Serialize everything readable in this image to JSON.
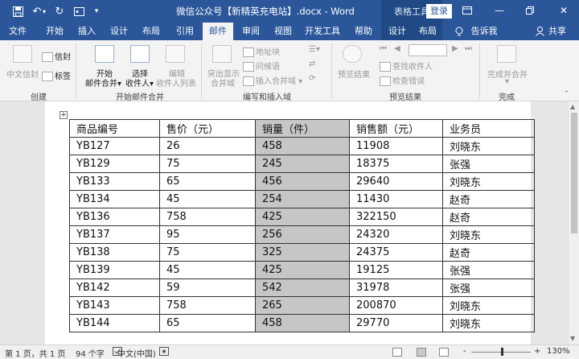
{
  "titlebar": {
    "title": "微信公众号【新精英充电站】.docx - Word",
    "tool_context": "表格工具",
    "login": "登录",
    "icons": [
      "save-icon",
      "undo-icon",
      "redo-icon",
      "customize-icon",
      "ribbon-display-icon",
      "minimize-icon",
      "restore-icon",
      "close-icon"
    ]
  },
  "tabs": [
    {
      "label": "文件"
    },
    {
      "label": "开始"
    },
    {
      "label": "插入"
    },
    {
      "label": "设计"
    },
    {
      "label": "布局"
    },
    {
      "label": "引用"
    },
    {
      "label": "邮件",
      "active": true
    },
    {
      "label": "审阅"
    },
    {
      "label": "视图"
    },
    {
      "label": "开发工具"
    },
    {
      "label": "帮助"
    },
    {
      "label": "设计"
    },
    {
      "label": "布局"
    }
  ],
  "tell_me": "告诉我",
  "share": "共享",
  "ribbon": {
    "groups": {
      "create": "创建",
      "start_merge": "开始邮件合并",
      "write_insert": "编写和插入域",
      "preview": "预览结果",
      "finish": "完成"
    },
    "buttons": {
      "cn_envelope": "中文信封",
      "envelope": "信封",
      "labels": "标签",
      "start_merge_1": "开始",
      "start_merge_2": "邮件合并",
      "select_recipients_1": "选择",
      "select_recipients_2": "收件人",
      "edit_list_1": "编辑",
      "edit_list_2": "收件人列表",
      "highlight_1": "突出显示",
      "highlight_2": "合并域",
      "address_block": "地址块",
      "greeting_line": "问候语",
      "insert_merge_field": "插入合并域",
      "preview_results": "预览结果",
      "find_recipient": "查找收件人",
      "check_errors": "检查错误",
      "finish_merge": "完成并合并"
    }
  },
  "table": {
    "headers": [
      "商品编号",
      "售价（元）",
      "销量（件）",
      "销售额（元）",
      "业务员"
    ],
    "rows": [
      [
        "YB127",
        "26",
        "458",
        "11908",
        "刘晓东"
      ],
      [
        "YB129",
        "75",
        "245",
        "18375",
        "张强"
      ],
      [
        "YB133",
        "65",
        "456",
        "29640",
        "刘晓东"
      ],
      [
        "YB134",
        "45",
        "254",
        "11430",
        "赵奇"
      ],
      [
        "YB136",
        "758",
        "425",
        "322150",
        "赵奇"
      ],
      [
        "YB137",
        "95",
        "256",
        "24320",
        "刘晓东"
      ],
      [
        "YB138",
        "75",
        "325",
        "24375",
        "赵奇"
      ],
      [
        "YB139",
        "45",
        "425",
        "19125",
        "张强"
      ],
      [
        "YB142",
        "59",
        "542",
        "31978",
        "张强"
      ],
      [
        "YB143",
        "758",
        "265",
        "200870",
        "刘晓东"
      ],
      [
        "YB144",
        "65",
        "458",
        "29770",
        "刘晓东"
      ]
    ],
    "highlight_column": 2
  },
  "status": {
    "page": "第 1 页，共 1 页",
    "words": "94 个字",
    "language": "中文(中国)",
    "zoom": "130%",
    "zoom_minus": "-",
    "zoom_plus": "+"
  }
}
